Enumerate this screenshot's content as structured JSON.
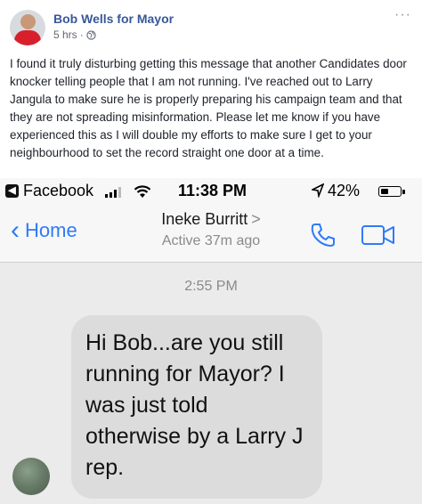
{
  "post": {
    "author": "Bob Wells for Mayor",
    "time": "5 hrs",
    "separator": "·",
    "more": "···",
    "text": "I found it truly disturbing getting this message that another Candidates door knocker telling people that I am not running. I've reached out to Larry Jangula to make sure he is properly preparing his campaign team and that they are not spreading misinformation. Please let me know if you have experienced this as I will double my efforts to make sure I get to your neighbourhood to set the record straight one door at a time."
  },
  "status_bar": {
    "back_app": "Facebook",
    "time": "11:38 PM",
    "battery": "42%",
    "battery_level": 0.42
  },
  "conversation": {
    "back_label": "Home",
    "contact_name": "Ineke Burritt",
    "contact_arrow": ">",
    "contact_status": "Active 37m ago",
    "timestamp": "2:55 PM",
    "message": "Hi Bob...are you still running for Mayor? I was just told otherwise by a Larry J rep."
  }
}
